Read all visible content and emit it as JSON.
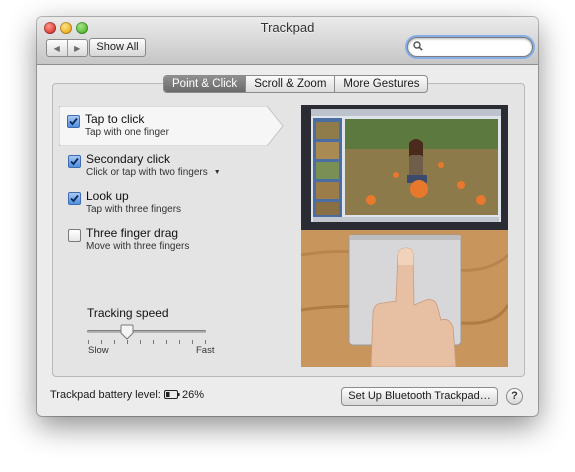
{
  "window": {
    "title": "Trackpad"
  },
  "toolbar": {
    "back_icon": "chevron-left-icon",
    "forward_icon": "chevron-right-icon",
    "show_all_label": "Show All",
    "search_value": "",
    "search_icon": "search-icon"
  },
  "tabs": [
    {
      "label": "Point & Click",
      "active": true
    },
    {
      "label": "Scroll & Zoom",
      "active": false
    },
    {
      "label": "More Gestures",
      "active": false
    }
  ],
  "gestures": [
    {
      "title": "Tap to click",
      "subtitle": "Tap with one finger",
      "checked": true,
      "selected": true
    },
    {
      "title": "Secondary click",
      "subtitle": "Click or tap with two fingers",
      "checked": true,
      "has_menu": true
    },
    {
      "title": "Look up",
      "subtitle": "Tap with three fingers",
      "checked": true
    },
    {
      "title": "Three finger drag",
      "subtitle": "Move with three fingers",
      "checked": false
    }
  ],
  "tracking": {
    "label": "Tracking speed",
    "min_label": "Slow",
    "max_label": "Fast",
    "tick_count": 10,
    "value_fraction": 0.33
  },
  "footer": {
    "battery_label": "Trackpad battery level:",
    "battery_value": "26%",
    "battery_icon": "battery-icon",
    "setup_button": "Set Up Bluetooth Trackpad…",
    "help_label": "?"
  },
  "colors": {
    "accent_blue": "#4f8fdf",
    "active_tab": "#7a7a7a",
    "window_bg": "#ececec"
  }
}
